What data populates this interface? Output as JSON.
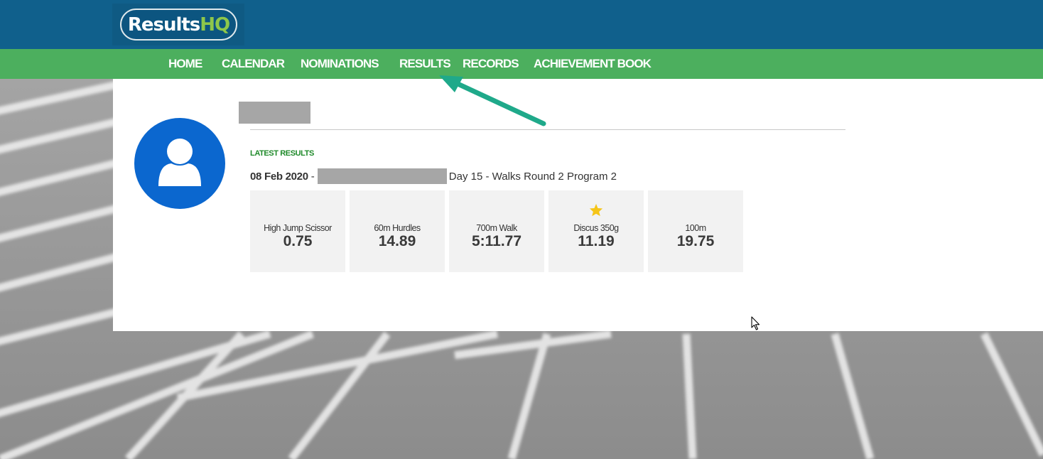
{
  "logo": {
    "text_white": "Results",
    "text_green": "HQ"
  },
  "nav": {
    "items": [
      {
        "label": "HOME"
      },
      {
        "label": "CALENDAR"
      },
      {
        "label": "NOMINATIONS"
      },
      {
        "label": "RESULTS"
      },
      {
        "label": "RECORDS"
      },
      {
        "label": "ACHIEVEMENT BOOK"
      }
    ]
  },
  "profile": {
    "section_label": "LATEST RESULTS",
    "meet_date": "08 Feb 2020",
    "meet_separator": "-",
    "meet_name": "Day 15 - Walks Round 2 Program 2"
  },
  "results": [
    {
      "event": "High Jump Scissor",
      "value": "0.75"
    },
    {
      "event": "60m Hurdles",
      "value": "14.89"
    },
    {
      "event": "700m Walk",
      "value": "5:11.77"
    },
    {
      "event": "Discus 350g",
      "value": "11.19",
      "icon": "star-icon"
    },
    {
      "event": "100m",
      "value": "19.75"
    }
  ],
  "colors": {
    "header_blue": "#10608c",
    "nav_green": "#4caf5e",
    "avatar_blue": "#0b67cf",
    "label_green": "#1f8a2a",
    "star_gold": "#f5c518",
    "arrow_teal": "#1fa98a"
  }
}
